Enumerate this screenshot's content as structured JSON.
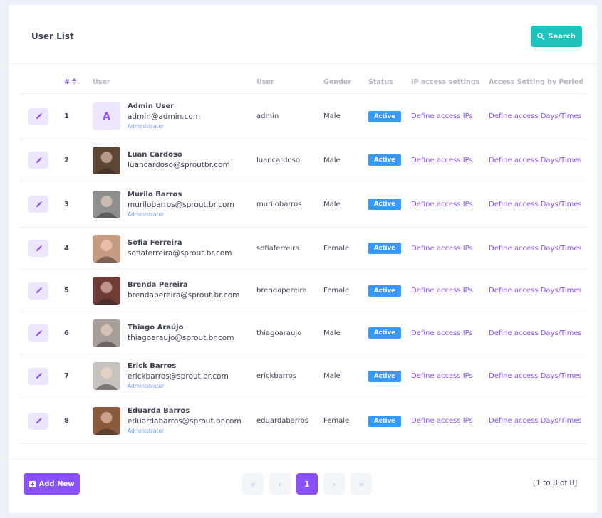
{
  "page": {
    "title": "User List",
    "search_label": "Search"
  },
  "table": {
    "headers": {
      "num": "#",
      "user": "User",
      "login": "User",
      "gender": "Gender",
      "status": "Status",
      "ip": "IP access settings",
      "period": "Access Setting by Period"
    },
    "rows": [
      {
        "index": "1",
        "avatar_letter": "A",
        "avatar_color": "#eee5ff",
        "name": "Admin User",
        "email": "admin@admin.com",
        "role": "Administrator",
        "login": "admin",
        "gender": "Male",
        "status": "Active",
        "ip_link": "Define access IPs",
        "period_link": "Define access Days/Times"
      },
      {
        "index": "2",
        "avatar_letter": "",
        "avatar_color": "#5b4636",
        "name": "Luan Cardoso",
        "email": "luancardoso@sproutbr.com",
        "role": "",
        "login": "luancardoso",
        "gender": "Male",
        "status": "Active",
        "ip_link": "Define access IPs",
        "period_link": "Define access Days/Times"
      },
      {
        "index": "3",
        "avatar_letter": "",
        "avatar_color": "#8d8f8e",
        "name": "Murilo Barros",
        "email": "murilobarros@sprout.br.com",
        "role": "Administrator",
        "login": "murilobarros",
        "gender": "Male",
        "status": "Active",
        "ip_link": "Define access IPs",
        "period_link": "Define access Days/Times"
      },
      {
        "index": "4",
        "avatar_letter": "",
        "avatar_color": "#c79a82",
        "name": "Sofia Ferreira",
        "email": "sofiaferreira@sprout.br.com",
        "role": "",
        "login": "sofiaferreira",
        "gender": "Female",
        "status": "Active",
        "ip_link": "Define access IPs",
        "period_link": "Define access Days/Times"
      },
      {
        "index": "5",
        "avatar_letter": "",
        "avatar_color": "#6e3b36",
        "name": "Brenda Pereira",
        "email": "brendapereira@sprout.br.com",
        "role": "",
        "login": "brendapereira",
        "gender": "Female",
        "status": "Active",
        "ip_link": "Define access IPs",
        "period_link": "Define access Days/Times"
      },
      {
        "index": "6",
        "avatar_letter": "",
        "avatar_color": "#a79e98",
        "name": "Thiago Araújo",
        "email": "thiagoaraujo@sprout.br.com",
        "role": "",
        "login": "thiagoaraujo",
        "gender": "Male",
        "status": "Active",
        "ip_link": "Define access IPs",
        "period_link": "Define access Days/Times"
      },
      {
        "index": "7",
        "avatar_letter": "",
        "avatar_color": "#c6c2bd",
        "name": "Erick Barros",
        "email": "erickbarros@sprout.br.com",
        "role": "Administrator",
        "login": "erickbarros",
        "gender": "Male",
        "status": "Active",
        "ip_link": "Define access IPs",
        "period_link": "Define access Days/Times"
      },
      {
        "index": "8",
        "avatar_letter": "",
        "avatar_color": "#8a5a3e",
        "name": "Eduarda Barros",
        "email": "eduardabarros@sprout.br.com",
        "role": "Administrator",
        "login": "eduardabarros",
        "gender": "Female",
        "status": "Active",
        "ip_link": "Define access IPs",
        "period_link": "Define access Days/Times"
      }
    ]
  },
  "footer": {
    "add_label": "Add New",
    "pager": {
      "first": "«",
      "prev": "‹",
      "current": "1",
      "next": "›",
      "last": "»"
    },
    "range_text": "[1 to 8 of 8]"
  },
  "colors": {
    "primary": "#8950fc",
    "info": "#1bc5bd",
    "status_active": "#3699ff"
  },
  "icons": {
    "search": "search-icon",
    "edit": "pencil-icon",
    "sort": "sort-icon",
    "add": "plus-square-icon"
  }
}
